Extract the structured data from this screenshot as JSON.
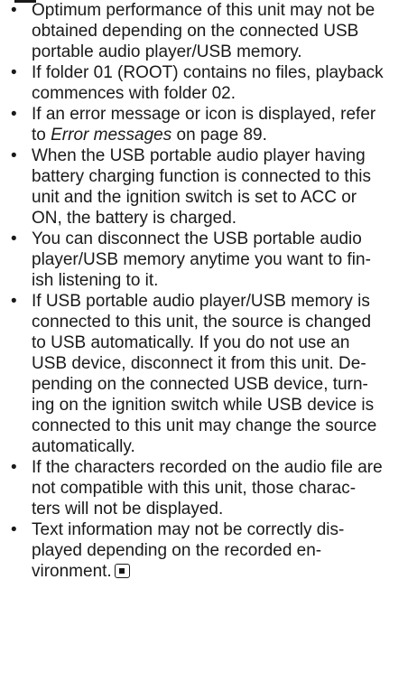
{
  "notes": {
    "bullet_glyph": "•",
    "items": [
      "Optimum performance of this unit may not be\nobtained depending on the connected USB\nportable audio player/USB memory.",
      "If folder 01 (ROOT) contains no files, playback\ncommences with folder 02.",
      {
        "before": "If an error message or icon is displayed, refer\nto ",
        "emphasis": "Error messages",
        "after": " on page 89."
      },
      "When the USB portable audio player having\nbattery charging function is connected to this\nunit and the ignition switch is set to ACC or\nON, the battery is charged.",
      "You can disconnect the USB portable audio\nplayer/USB memory anytime you want to fin-\nish listening to it.",
      "If USB portable audio player/USB memory is\nconnected to this unit, the source is changed\nto USB automatically. If you do not use an\nUSB device, disconnect it from this unit. De-\npending on the connected USB device, turn-\ning on the ignition switch while USB device is\nconnected to this unit may change the source\nautomatically.",
      "If the characters recorded on the audio file are\nnot compatible with this unit, those charac-\nters will not be displayed.",
      "Text information may not be correctly dis-\nplayed depending on the recorded en-\nvironment."
    ],
    "end_mark_icon": "end-of-section-icon"
  }
}
